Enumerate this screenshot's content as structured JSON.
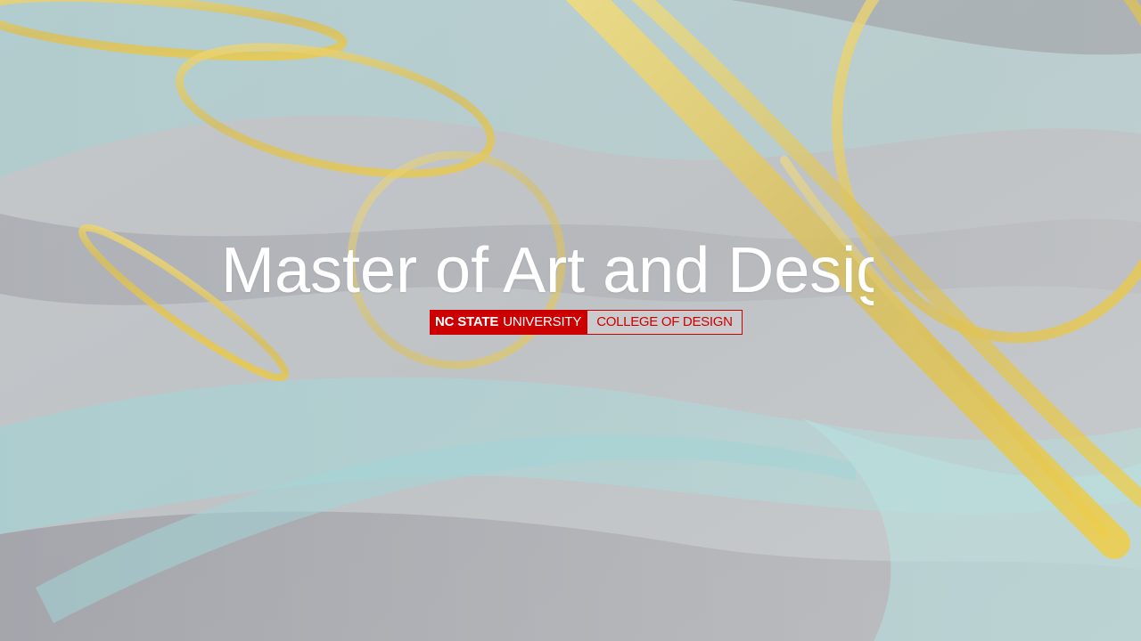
{
  "slide": {
    "title": "Master of Art and Desig",
    "logo": {
      "part1": "NC STATE",
      "part2": "UNIVERSITY",
      "part3": "COLLEGE OF DESIGN"
    }
  },
  "colors": {
    "logo_red": "#cc0000",
    "ring_gold": "#e8c852",
    "wave_teal": "#a9d6d6",
    "wave_gray": "#a7a6aa"
  }
}
